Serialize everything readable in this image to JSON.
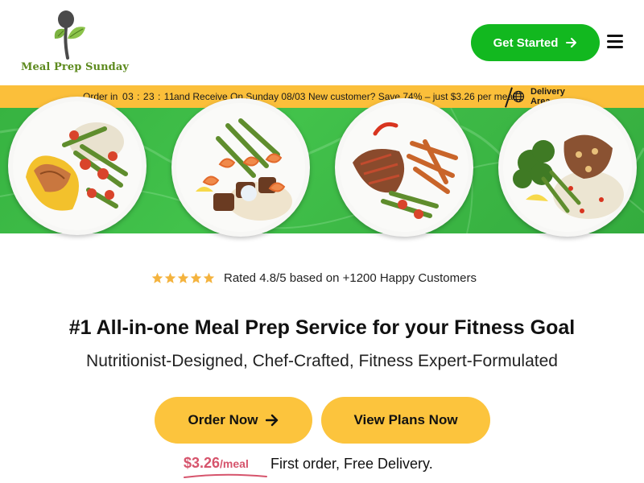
{
  "brand": {
    "name": "Meal Prep Sunday",
    "accent_green": "#12b81f",
    "logo_green": "#5d8a1e",
    "accent_yellow": "#fcc43d",
    "bar_yellow": "#fbbf3a",
    "price_color": "#d6546c"
  },
  "header": {
    "cta_label": "Get Started",
    "cta_icon": "arrow-right-icon",
    "menu_icon": "hamburger-menu-icon"
  },
  "announcement": {
    "order_in": "Order in",
    "countdown": "03 : 23 : 11",
    "receive": "and Receive On Sunday 08/03",
    "offer": "New customer? Save 74% – just $3.26 per meal",
    "delivery_line1": "Delivery",
    "delivery_line2": "Area",
    "delivery_icon": "globe-icon"
  },
  "hero": {
    "plates": [
      "salmon-plate",
      "shrimp-steak-plate",
      "steak-fries-plate",
      "chicken-broccoli-plate"
    ]
  },
  "rating": {
    "stars": 5,
    "text": "Rated 4.8/5 based on +1200 Happy Customers"
  },
  "main": {
    "headline": "#1 All-in-one Meal Prep Service for your Fitness Goal",
    "subheadline": "Nutritionist-Designed, Chef-Crafted, Fitness Expert-Formulated",
    "order_label": "Order Now",
    "plans_label": "View Plans Now",
    "price": "$3.26",
    "price_unit": "/meal",
    "price_note": "First order, Free Delivery."
  }
}
